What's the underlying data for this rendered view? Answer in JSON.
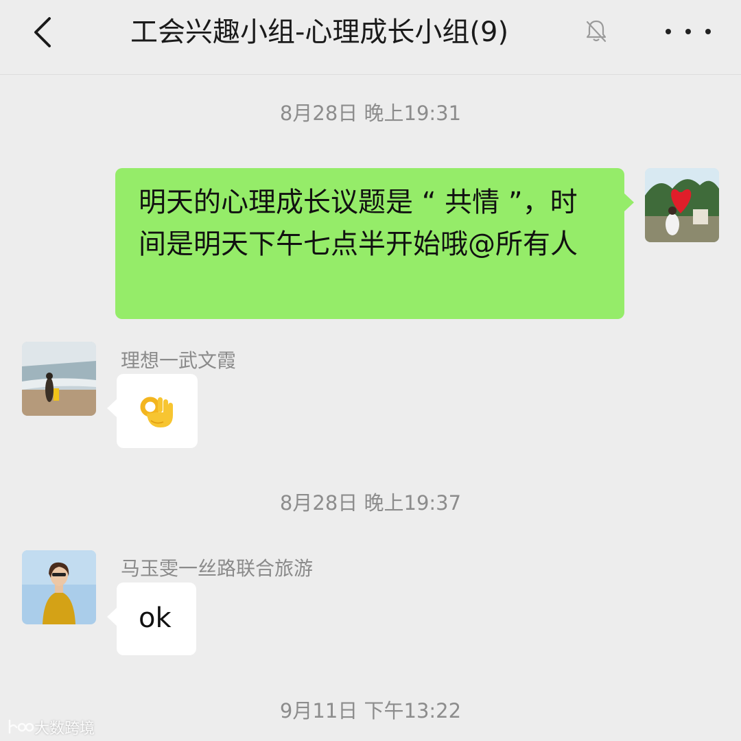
{
  "header": {
    "title": "工会兴趣小组-心理成长小组(9)",
    "back_icon": "chevron-left-icon",
    "mute_icon": "bell-muted-icon",
    "more_icon": "ellipsis-icon"
  },
  "messages": [
    {
      "type": "timestamp",
      "text": "8月28日 晚上19:31"
    },
    {
      "type": "outgoing",
      "text": "明天的心理成长议题是 “ 共情 ”，时间是明天下午七点半开始哦@所有人"
    },
    {
      "type": "incoming",
      "sender": "理想一武文霞",
      "content_icon": "ok-hand-emoji-icon"
    },
    {
      "type": "timestamp",
      "text": "8月28日 晚上19:37"
    },
    {
      "type": "incoming",
      "sender": "马玉雯一丝路联合旅游",
      "text": "ok"
    },
    {
      "type": "timestamp",
      "text": "9月11日 下午13:22"
    }
  ],
  "colors": {
    "background": "#ededed",
    "outgoing_bubble": "#95ec69",
    "incoming_bubble": "#ffffff",
    "timestamp_text": "#8c8c8c"
  },
  "watermark": {
    "text": "大数跨境"
  }
}
